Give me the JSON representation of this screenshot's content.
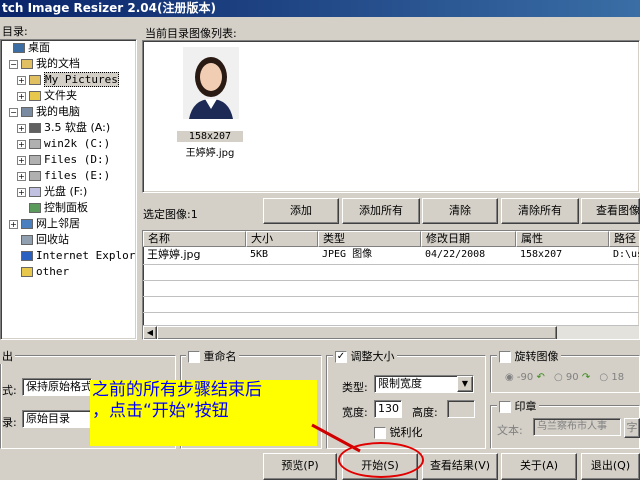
{
  "window": {
    "title": "tch Image Resizer 2.04(注册版本)"
  },
  "left_panel": {
    "label": "目录:"
  },
  "tree": [
    {
      "label": "桌面",
      "indent": 0,
      "icon": "desktop-icon",
      "expander": ""
    },
    {
      "label": "我的文档",
      "indent": 1,
      "icon": "documents-icon",
      "expander": "−"
    },
    {
      "label": "My Pictures",
      "indent": 2,
      "icon": "pictures-folder-icon",
      "expander": "+",
      "selected": true
    },
    {
      "label": "文件夹",
      "indent": 2,
      "icon": "folder-icon",
      "expander": "+"
    },
    {
      "label": "我的电脑",
      "indent": 1,
      "icon": "computer-icon",
      "expander": "−"
    },
    {
      "label": "3.5 软盘 (A:)",
      "indent": 2,
      "icon": "floppy-icon",
      "expander": "+"
    },
    {
      "label": "win2k (C:)",
      "indent": 2,
      "icon": "drive-icon",
      "expander": "+"
    },
    {
      "label": "Files (D:)",
      "indent": 2,
      "icon": "drive-icon",
      "expander": "+"
    },
    {
      "label": "files (E:)",
      "indent": 2,
      "icon": "drive-icon",
      "expander": "+"
    },
    {
      "label": "光盘 (F:)",
      "indent": 2,
      "icon": "cdrom-icon",
      "expander": "+"
    },
    {
      "label": "控制面板",
      "indent": 2,
      "icon": "control-panel-icon",
      "expander": ""
    },
    {
      "label": "网上邻居",
      "indent": 1,
      "icon": "network-icon",
      "expander": "+"
    },
    {
      "label": "回收站",
      "indent": 1,
      "icon": "recycle-bin-icon",
      "expander": ""
    },
    {
      "label": "Internet Explorer",
      "indent": 1,
      "icon": "ie-icon",
      "expander": ""
    },
    {
      "label": "other",
      "indent": 1,
      "icon": "folder-icon",
      "expander": ""
    }
  ],
  "images_panel": {
    "label": "当前目录图像列表:"
  },
  "thumbnail": {
    "dimensions": "158x207",
    "filename": "王婷婷.jpg"
  },
  "selection": {
    "label": "选定图像:1"
  },
  "buttons": {
    "add": "添加",
    "add_all": "添加所有",
    "clear": "清除",
    "clear_all": "清除所有",
    "view_image": "查看图像",
    "preview": "预览(P)",
    "start": "开始(S)",
    "view_result": "查看结果(V)",
    "about": "关于(A)",
    "exit": "退出(Q)"
  },
  "table": {
    "headers": [
      "名称",
      "大小",
      "类型",
      "修改日期",
      "属性",
      "路径"
    ],
    "rows": [
      [
        "王婷婷.jpg",
        "5KB",
        "JPEG 图像",
        "04/22/2008",
        "158x207",
        "D:\\us"
      ]
    ]
  },
  "output_group": {
    "title": "出",
    "format_label": "式:",
    "format_value": "保持原始格式",
    "dir_label": "录:",
    "dir_value": "原始目录"
  },
  "rename_group": {
    "title": "重命名",
    "checked": false
  },
  "resize_group": {
    "title": "调整大小",
    "checked": true,
    "type_label": "类型:",
    "type_value": "限制宽度",
    "width_label": "宽度:",
    "width_value": "130",
    "height_label": "高度:",
    "height_value": "",
    "sharpen_label": "锐利化",
    "sharpen_checked": false
  },
  "rotate_group": {
    "title": "旋转图像",
    "checked": false,
    "options": [
      "-90",
      "90",
      "18"
    ]
  },
  "watermark_group": {
    "title": "印章",
    "checked": false,
    "text_label": "文本:",
    "text_value": "乌兰察布市人事",
    "font_button": "字"
  },
  "annotation": {
    "line1": "之前的所有步骤结束后",
    "line2": "，点击“开始”按钮",
    "bg_color": "#ffff00",
    "text_color": "#0000ff",
    "circle_color": "#ff0000"
  }
}
